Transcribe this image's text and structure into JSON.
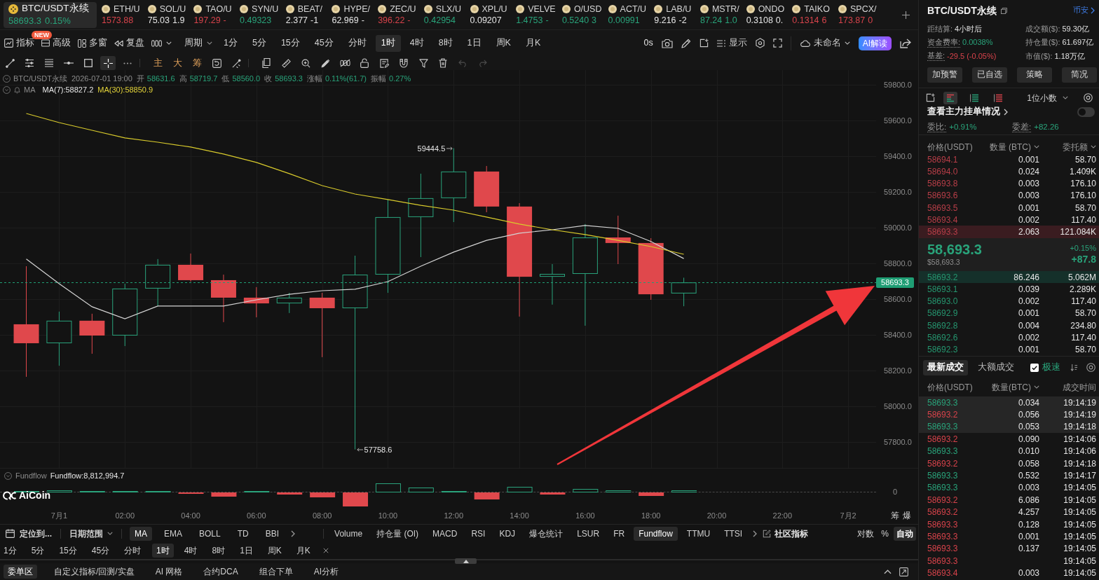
{
  "ticker_bar": {
    "tickers": [
      {
        "symbol": "BTC/USDT永续",
        "price": "58693.3",
        "change": "0.15%",
        "color": "#29a37a",
        "selected": true
      },
      {
        "symbol": "ETH/U",
        "price": "1573.88",
        "color": "#d8434b",
        "selected": false
      },
      {
        "symbol": "SOL/U",
        "price": "75.03",
        "change": "1.9",
        "color": "#e6e6e6",
        "selected": false
      },
      {
        "symbol": "TAO/U",
        "price": "197.29",
        "change": "-",
        "color": "#d8434b",
        "selected": false
      },
      {
        "symbol": "SYN/U",
        "price": "0.49323",
        "color": "#29a37a",
        "selected": false
      },
      {
        "symbol": "BEAT/",
        "price": "2.377",
        "change": "-1",
        "color": "#e6e6e6",
        "selected": false
      },
      {
        "symbol": "HYPE/",
        "price": "62.969",
        "change": "-",
        "color": "#e6e6e6",
        "selected": false
      },
      {
        "symbol": "ZEC/U",
        "price": "396.22",
        "change": "-",
        "color": "#d8434b",
        "selected": false
      },
      {
        "symbol": "SLX/U",
        "price": "0.42954",
        "color": "#29a37a",
        "selected": false
      },
      {
        "symbol": "XPL/U",
        "price": "0.09207",
        "color": "#e6e6e6",
        "selected": false
      },
      {
        "symbol": "VELVE",
        "price": "1.4753",
        "change": "-",
        "color": "#29a37a",
        "selected": false
      },
      {
        "symbol": "O/USD",
        "price": "0.5240",
        "change": "3",
        "color": "#29a37a",
        "selected": false
      },
      {
        "symbol": "ACT/U",
        "price": "0.00991",
        "color": "#29a37a",
        "selected": false
      },
      {
        "symbol": "LAB/U",
        "price": "9.216",
        "change": "-2",
        "color": "#e6e6e6",
        "selected": false
      },
      {
        "symbol": "MSTR/",
        "price": "87.24",
        "change": "1.0",
        "color": "#29a37a",
        "selected": false
      },
      {
        "symbol": "ONDO",
        "price": "0.3108",
        "change": "0.",
        "color": "#e6e6e6",
        "selected": false
      },
      {
        "symbol": "TAIKO",
        "price": "0.1314",
        "change": "6",
        "color": "#d8434b",
        "selected": false
      },
      {
        "symbol": "SPCX/",
        "price": "173.87",
        "change": "0",
        "color": "#d8434b",
        "selected": false
      }
    ]
  },
  "main_toolbar": {
    "tools": [
      {
        "label": "指标"
      },
      {
        "label": "高级",
        "badge": "NEW"
      },
      {
        "label": "多窗"
      },
      {
        "label": "复盘"
      }
    ],
    "period_label": "周期",
    "periods": [
      {
        "label": "1分",
        "selected": false
      },
      {
        "label": "5分",
        "selected": false
      },
      {
        "label": "15分",
        "selected": false
      },
      {
        "label": "45分",
        "selected": false
      },
      {
        "label": "分时",
        "selected": false
      },
      {
        "label": "1时",
        "selected": true
      },
      {
        "label": "4时",
        "selected": false
      },
      {
        "label": "8时",
        "selected": false
      },
      {
        "label": "1日",
        "selected": false
      },
      {
        "label": "周K",
        "selected": false
      },
      {
        "label": "月K",
        "selected": false
      }
    ],
    "timer": "0s",
    "display_label": "显示",
    "layout_name": "未命名",
    "ai_button": "AI解读"
  },
  "drawing_toolbar": {
    "tools": [
      {
        "selected": false
      },
      {
        "selected": false
      },
      {
        "selected": false
      },
      {
        "selected": false
      },
      {
        "selected": false
      },
      {
        "selected": true
      }
    ],
    "shortcuts": [
      "主",
      "大",
      "筹"
    ]
  },
  "chart": {
    "header": {
      "symbol": "BTC/USDT永续",
      "time": "2026-07-01 19:00",
      "fields": [
        {
          "label": "开",
          "value": "58631.6"
        },
        {
          "label": "高",
          "value": "58719.7"
        },
        {
          "label": "低",
          "value": "58560.0"
        },
        {
          "label": "收",
          "value": "58693.3"
        },
        {
          "label": "涨幅",
          "value": "0.11%(61.7)"
        },
        {
          "label": "振幅",
          "value": "0.27%"
        }
      ]
    },
    "ma_legend": {
      "label": "MA",
      "lines": [
        {
          "text": "MA(7):58827.2",
          "color": "#e6e6e6"
        },
        {
          "text": "MA(30):58850.9",
          "color": "#e3d33a"
        }
      ]
    },
    "chart_data": [
      {
        "type": "candlestick",
        "x": [
          "2026-06-30T23:00",
          "2026-07-01T00:00",
          "2026-07-01T01:00",
          "2026-07-01T02:00",
          "2026-07-01T03:00",
          "2026-07-01T04:00",
          "2026-07-01T05:00",
          "2026-07-01T06:00",
          "2026-07-01T07:00",
          "2026-07-01T08:00",
          "2026-07-01T09:00",
          "2026-07-01T10:00",
          "2026-07-01T11:00",
          "2026-07-01T12:00",
          "2026-07-01T13:00",
          "2026-07-01T14:00",
          "2026-07-01T15:00",
          "2026-07-01T16:00",
          "2026-07-01T17:00",
          "2026-07-01T18:00",
          "2026-07-01T19:00"
        ],
        "ohlc": [
          [
            58459,
            58784,
            58165,
            58353
          ],
          [
            58353,
            58530,
            58227,
            58479
          ],
          [
            58479,
            58518,
            58294,
            58396
          ],
          [
            58396,
            58686,
            58337,
            58659
          ],
          [
            58659,
            58824,
            58561,
            58792
          ],
          [
            58792,
            58855,
            58698,
            58706
          ],
          [
            58706,
            58737,
            58471,
            58608
          ],
          [
            58608,
            58667,
            58498,
            58576
          ],
          [
            58576,
            58635,
            58522,
            58608
          ],
          [
            58608,
            58635,
            58275,
            58549
          ],
          [
            58549,
            58843,
            57758.6,
            58737
          ],
          [
            58737,
            59157,
            58635,
            59059
          ],
          [
            59059,
            59302,
            58835,
            59165
          ],
          [
            59165,
            59444.5,
            59031,
            59314
          ],
          [
            59314,
            59345,
            59086,
            59118
          ],
          [
            59118,
            59137,
            58502,
            58725
          ],
          [
            58725,
            58796,
            58569,
            58741
          ],
          [
            58741,
            59020,
            58451,
            58945
          ],
          [
            58945,
            59067,
            58796,
            58914
          ],
          [
            58914,
            58941,
            58596,
            58627
          ],
          [
            58631.6,
            58719.7,
            58560.0,
            58693.3
          ]
        ],
        "series": [
          {
            "type": "line",
            "color": "#d4d4d4",
            "values": [
              58824,
              58686,
              58557,
              58490,
              58561,
              58561,
              58561,
              58596,
              58627,
              58647,
              58655,
              58698,
              58784,
              58863,
              58929,
              58969,
              58988,
              59012,
              58996,
              58922,
              58827
            ]
          },
          {
            "type": "line",
            "color": "#d9cb2c",
            "values": [
              59639,
              59588,
              59545,
              59502,
              59478,
              59451,
              59412,
              59365,
              59302,
              59235,
              59188,
              59157,
              59125,
              59098,
              59059,
              59020,
              58988,
              58961,
              58929,
              58894,
              58851
            ]
          }
        ],
        "xlim": [
          "2026-06-30T22:12",
          "2026-07-02T00:51"
        ],
        "ylim": [
          57655,
          59882
        ],
        "xticks": [
          {
            "value": "2026-07-01T00:00",
            "label": "7月1"
          },
          {
            "value": "2026-07-01T02:00",
            "label": "02:00"
          },
          {
            "value": "2026-07-01T04:00",
            "label": "04:00"
          },
          {
            "value": "2026-07-01T06:00",
            "label": "06:00"
          },
          {
            "value": "2026-07-01T08:00",
            "label": "08:00"
          },
          {
            "value": "2026-07-01T10:00",
            "label": "10:00"
          },
          {
            "value": "2026-07-01T12:00",
            "label": "12:00"
          },
          {
            "value": "2026-07-01T14:00",
            "label": "14:00"
          },
          {
            "value": "2026-07-01T16:00",
            "label": "16:00"
          },
          {
            "value": "2026-07-01T18:00",
            "label": "18:00"
          },
          {
            "value": "2026-07-01T20:00",
            "label": "20:00"
          },
          {
            "value": "2026-07-01T22:00",
            "label": "22:00"
          },
          {
            "value": "2026-07-02T00:00",
            "label": "7月2"
          }
        ],
        "yticks": [
          {
            "value": 59800,
            "label": "59800.0"
          },
          {
            "value": 59600,
            "label": "59600.0"
          },
          {
            "value": 59400,
            "label": "59400.0"
          },
          {
            "value": 59200,
            "label": "59200.0"
          },
          {
            "value": 59000,
            "label": "59000.0"
          },
          {
            "value": 58800,
            "label": "58800.0"
          },
          {
            "value": 58600,
            "label": "58600.0"
          },
          {
            "value": 58400,
            "label": "58400.0"
          },
          {
            "value": 58200,
            "label": "58200.0"
          },
          {
            "value": 58000,
            "label": "58000.0"
          },
          {
            "value": 57800,
            "label": "57800.0"
          }
        ],
        "grid": true,
        "ref_lines": [
          {
            "axis": "y",
            "value": 58693.3,
            "label": "58693.3",
            "color": "#1f9e74",
            "line_style": "dashed"
          }
        ],
        "annotations": [
          "59444.5",
          "57758.6"
        ]
      }
    ],
    "fundflow": {
      "name": "Fundflow",
      "reading": "Fundflow:8,812,994.7",
      "zero_label": "0"
    },
    "logo": "AiCoin",
    "axis_buttons": [
      "筹",
      "爆"
    ]
  },
  "indicator_bar": {
    "locate": "定位到...",
    "date_range": "日期范围",
    "main_indicators": [
      {
        "label": "MA",
        "selected": true
      },
      {
        "label": "EMA",
        "selected": false
      },
      {
        "label": "BOLL",
        "selected": false
      },
      {
        "label": "TD",
        "selected": false
      },
      {
        "label": "BBI",
        "selected": false
      }
    ],
    "sub_indicators": [
      {
        "label": "Volume",
        "selected": false
      },
      {
        "label": "持仓量 (OI)",
        "selected": false
      },
      {
        "label": "MACD",
        "selected": false
      },
      {
        "label": "RSI",
        "selected": false
      },
      {
        "label": "KDJ",
        "selected": false
      },
      {
        "label": "爆仓统计",
        "selected": false
      },
      {
        "label": "LSUR",
        "selected": false
      },
      {
        "label": "FR",
        "selected": false
      },
      {
        "label": "Fundflow",
        "selected": true
      },
      {
        "label": "TTMU",
        "selected": false
      },
      {
        "label": "TTSI",
        "selected": false
      }
    ],
    "community": "社区指标",
    "scale_modes": [
      {
        "label": "对数",
        "selected": false
      },
      {
        "label": "%",
        "selected": false
      },
      {
        "label": "自动",
        "selected": true
      }
    ]
  },
  "period_bar": {
    "periods": [
      {
        "label": "1分",
        "selected": false
      },
      {
        "label": "5分",
        "selected": false
      },
      {
        "label": "15分",
        "selected": false
      },
      {
        "label": "45分",
        "selected": false
      },
      {
        "label": "分时",
        "selected": false
      },
      {
        "label": "1时",
        "selected": true
      },
      {
        "label": "4时",
        "selected": false
      },
      {
        "label": "8时",
        "selected": false
      },
      {
        "label": "1日",
        "selected": false
      },
      {
        "label": "周K",
        "selected": false
      },
      {
        "label": "月K",
        "selected": false
      }
    ]
  },
  "bottom_tabs": [
    {
      "label": "委单区",
      "selected": true
    },
    {
      "label": "自定义指标/回测/实盘",
      "selected": false
    },
    {
      "label": "AI 网格",
      "selected": false
    },
    {
      "label": "合约DCA",
      "selected": false
    },
    {
      "label": "组合下单",
      "selected": false
    },
    {
      "label": "AI分析",
      "selected": false
    }
  ],
  "market_panel": {
    "title": "BTC/USDT永续",
    "exchange_link": "币安",
    "stats": [
      {
        "label": "距结算:",
        "value": "4小时后",
        "underlined": false
      },
      {
        "label": "成交额($):",
        "value": "59.30亿",
        "underlined": false
      },
      {
        "label": "资金费率:",
        "value": "0.0038%",
        "color": "#29a37a",
        "underlined": true
      },
      {
        "label": "持仓量($):",
        "value": "61.697亿",
        "underlined": false
      },
      {
        "label": "基差:",
        "value": "-29.5 (-0.05%)",
        "color": "#d8434b",
        "underlined": true
      },
      {
        "label": "市值($):",
        "value": "1.18万亿",
        "underlined": false
      }
    ],
    "buttons": [
      "加预警",
      "已自选",
      "策略",
      "简况"
    ],
    "order_book": {
      "view_modes": [
        {
          "selected": true
        },
        {
          "selected": false
        },
        {
          "selected": false
        }
      ],
      "precision": "1位小数",
      "whale_orders": {
        "label": "查看主力挂单情况",
        "on": false
      },
      "ratio": {
        "label": "委比:",
        "value": "+0.91%"
      },
      "difference": {
        "label": "委差:",
        "value": "+82.26"
      },
      "columns": [
        {
          "label": "价格(USDT)",
          "dropdown": false
        },
        {
          "label": "数量 (BTC)",
          "dropdown": true
        },
        {
          "label": "委托额",
          "dropdown": true
        }
      ],
      "asks": [
        {
          "price": "58694.1",
          "amount": "0.001",
          "total": "58.70",
          "highlighted": false
        },
        {
          "price": "58694.0",
          "amount": "0.024",
          "total": "1.409K",
          "highlighted": false
        },
        {
          "price": "58693.8",
          "amount": "0.003",
          "total": "176.10",
          "highlighted": false
        },
        {
          "price": "58693.6",
          "amount": "0.003",
          "total": "176.10",
          "highlighted": false
        },
        {
          "price": "58693.5",
          "amount": "0.001",
          "total": "58.70",
          "highlighted": false
        },
        {
          "price": "58693.4",
          "amount": "0.002",
          "total": "117.40",
          "highlighted": false
        },
        {
          "price": "58693.3",
          "amount": "2.063",
          "total": "121.084K",
          "highlighted": true
        }
      ],
      "last_price": {
        "price": "58,693.3",
        "usd": "$58,693.3",
        "change_pct": "+0.15%",
        "change": "+87.8"
      },
      "bids": [
        {
          "price": "58693.2",
          "amount": "86.246",
          "total": "5.062M",
          "highlighted": true
        },
        {
          "price": "58693.1",
          "amount": "0.039",
          "total": "2.289K",
          "highlighted": false
        },
        {
          "price": "58693.0",
          "amount": "0.002",
          "total": "117.40",
          "highlighted": false
        },
        {
          "price": "58692.9",
          "amount": "0.001",
          "total": "58.70",
          "highlighted": false
        },
        {
          "price": "58692.8",
          "amount": "0.004",
          "total": "234.80",
          "highlighted": false
        },
        {
          "price": "58692.6",
          "amount": "0.002",
          "total": "117.40",
          "highlighted": false
        },
        {
          "price": "58692.3",
          "amount": "0.001",
          "total": "58.70",
          "highlighted": false
        }
      ]
    },
    "trades": {
      "tabs": [
        {
          "label": "最新成交",
          "selected": true
        },
        {
          "label": "大额成交",
          "selected": false
        }
      ],
      "fast_mode": {
        "label": "极速",
        "checked": true
      },
      "columns": [
        {
          "label": "价格(USDT)",
          "dropdown": false
        },
        {
          "label": "数量(BTC)",
          "dropdown": true
        },
        {
          "label": "成交时间",
          "dropdown": false
        }
      ],
      "rows": [
        {
          "price": "58693.3",
          "amount": "0.034",
          "time": "19:14:19",
          "color": "#29a37a",
          "highlighted": true
        },
        {
          "price": "58693.2",
          "amount": "0.056",
          "time": "19:14:19",
          "color": "#d8434b",
          "highlighted": true
        },
        {
          "price": "58693.3",
          "amount": "0.053",
          "time": "19:14:18",
          "color": "#29a37a",
          "highlighted": true
        },
        {
          "price": "58693.2",
          "amount": "0.090",
          "time": "19:14:06",
          "color": "#d8434b",
          "highlighted": false
        },
        {
          "price": "58693.3",
          "amount": "0.010",
          "time": "19:14:06",
          "color": "#29a37a",
          "highlighted": false
        },
        {
          "price": "58693.2",
          "amount": "0.058",
          "time": "19:14:18",
          "color": "#d8434b",
          "highlighted": false
        },
        {
          "price": "58693.3",
          "amount": "0.532",
          "time": "19:14:17",
          "color": "#29a37a",
          "highlighted": false
        },
        {
          "price": "58693.3",
          "amount": "0.003",
          "time": "19:14:05",
          "color": "#29a37a",
          "highlighted": false
        },
        {
          "price": "58693.2",
          "amount": "6.086",
          "time": "19:14:05",
          "color": "#d8434b",
          "highlighted": false
        },
        {
          "price": "58693.2",
          "amount": "4.257",
          "time": "19:14:05",
          "color": "#d8434b",
          "highlighted": false
        },
        {
          "price": "58693.3",
          "amount": "0.128",
          "time": "19:14:05",
          "color": "#d8434b",
          "highlighted": false
        },
        {
          "price": "58693.3",
          "amount": "0.001",
          "time": "19:14:05",
          "color": "#d8434b",
          "highlighted": false
        },
        {
          "price": "58693.3",
          "amount": "0.137",
          "time": "19:14:05",
          "color": "#d8434b",
          "highlighted": false
        },
        {
          "price": "58693.3",
          "time": "19:14:05",
          "color": "#d8434b",
          "highlighted": false
        },
        {
          "price": "58693.4",
          "amount": "0.003",
          "time": "19:14:05",
          "color": "#d8434b",
          "highlighted": false
        }
      ]
    }
  }
}
